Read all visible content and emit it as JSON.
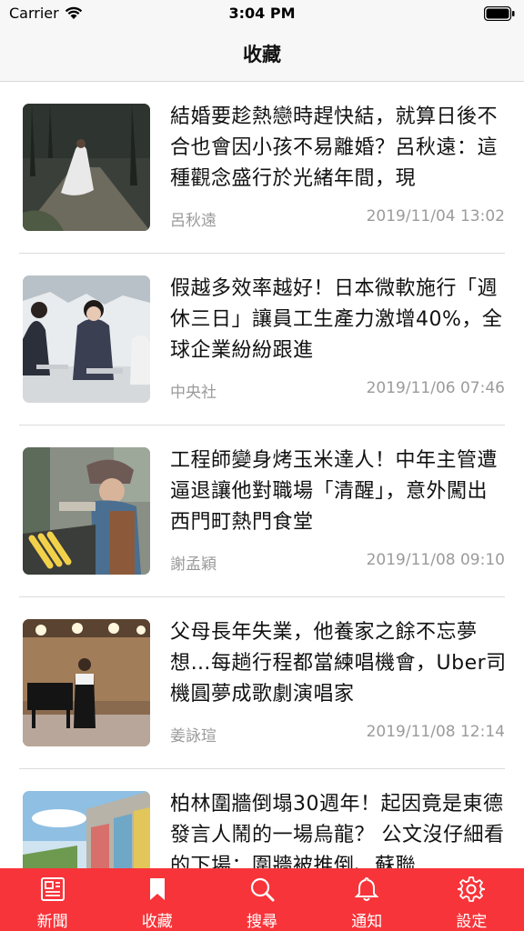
{
  "status": {
    "carrier": "Carrier",
    "time": "3:04 PM"
  },
  "nav": {
    "title": "收藏"
  },
  "articles": [
    {
      "title": "結婚要趁熱戀時趕快結，就算日後不合也會因小孩不易離婚？呂秋遠：這種觀念盛行於光緒年間，現",
      "author": "呂秋遠",
      "date": "2019/11/04 13:02",
      "image": "woman-in-white-dress-forest"
    },
    {
      "title": "假越多效率越好！日本微軟施行「週休三日」讓員工生產力激增40%，全球企業紛紛跟進",
      "author": "中央社",
      "date": "2019/11/06 07:46",
      "image": "office-workers-laptops"
    },
    {
      "title": "工程師變身烤玉米達人！中年主管遭逼退讓他對職場「清醒」，意外闖出西門町熱門食堂",
      "author": "謝孟穎",
      "date": "2019/11/08 09:10",
      "image": "man-grilling-corn"
    },
    {
      "title": "父母長年失業，他養家之餘不忘夢想…每趟行程都當練唱機會，Uber司機圓夢成歌劇演唱家",
      "author": "姜詠瑄",
      "date": "2019/11/08 12:14",
      "image": "singer-on-stage"
    },
    {
      "title": "柏林圍牆倒塌30週年！起因竟是東德發言人鬧的一場烏龍？ 公文沒仔細看的下場：圍牆被推倒、蘇聯",
      "author": "",
      "date": "",
      "image": "berlin-wall"
    }
  ],
  "tabs": [
    {
      "label": "新聞",
      "icon": "news-icon"
    },
    {
      "label": "收藏",
      "icon": "bookmark-icon"
    },
    {
      "label": "搜尋",
      "icon": "search-icon"
    },
    {
      "label": "通知",
      "icon": "bell-icon"
    },
    {
      "label": "設定",
      "icon": "gear-icon"
    }
  ],
  "colors": {
    "accent": "#f7343a",
    "meta_text": "#9b9b9b"
  }
}
